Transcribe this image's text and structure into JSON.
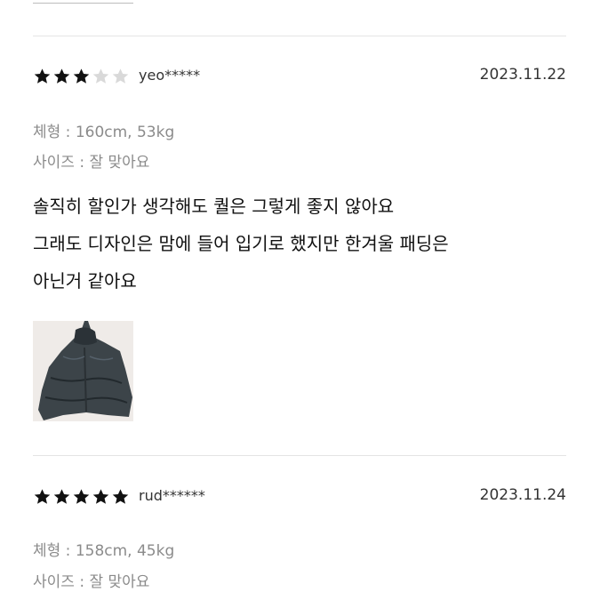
{
  "reviews": [
    {
      "rating": 3,
      "max_rating": 5,
      "user": "yeo*****",
      "date": "2023.11.22",
      "body_info": "체형 : 160cm, 53kg",
      "size_info": "사이즈 : 잘 맞아요",
      "text_lines": [
        "솔직히 할인가 생각해도 퀄은 그렇게 좋지 않아요",
        "그래도 디자인은 맘에 들어 입기로 했지만 한겨울 패딩은",
        "아닌거 같아요"
      ],
      "has_photo": true
    },
    {
      "rating": 5,
      "max_rating": 5,
      "user": "rud******",
      "date": "2023.11.24",
      "body_info": "체형 : 158cm, 45kg",
      "size_info": "사이즈 : 잘 맞아요"
    }
  ],
  "colors": {
    "star_filled": "#111111",
    "star_empty": "#d9d9d9",
    "secondary_text": "#8b8b8b",
    "divider": "#e4e4e4"
  },
  "icons": {
    "star": "star-icon"
  }
}
